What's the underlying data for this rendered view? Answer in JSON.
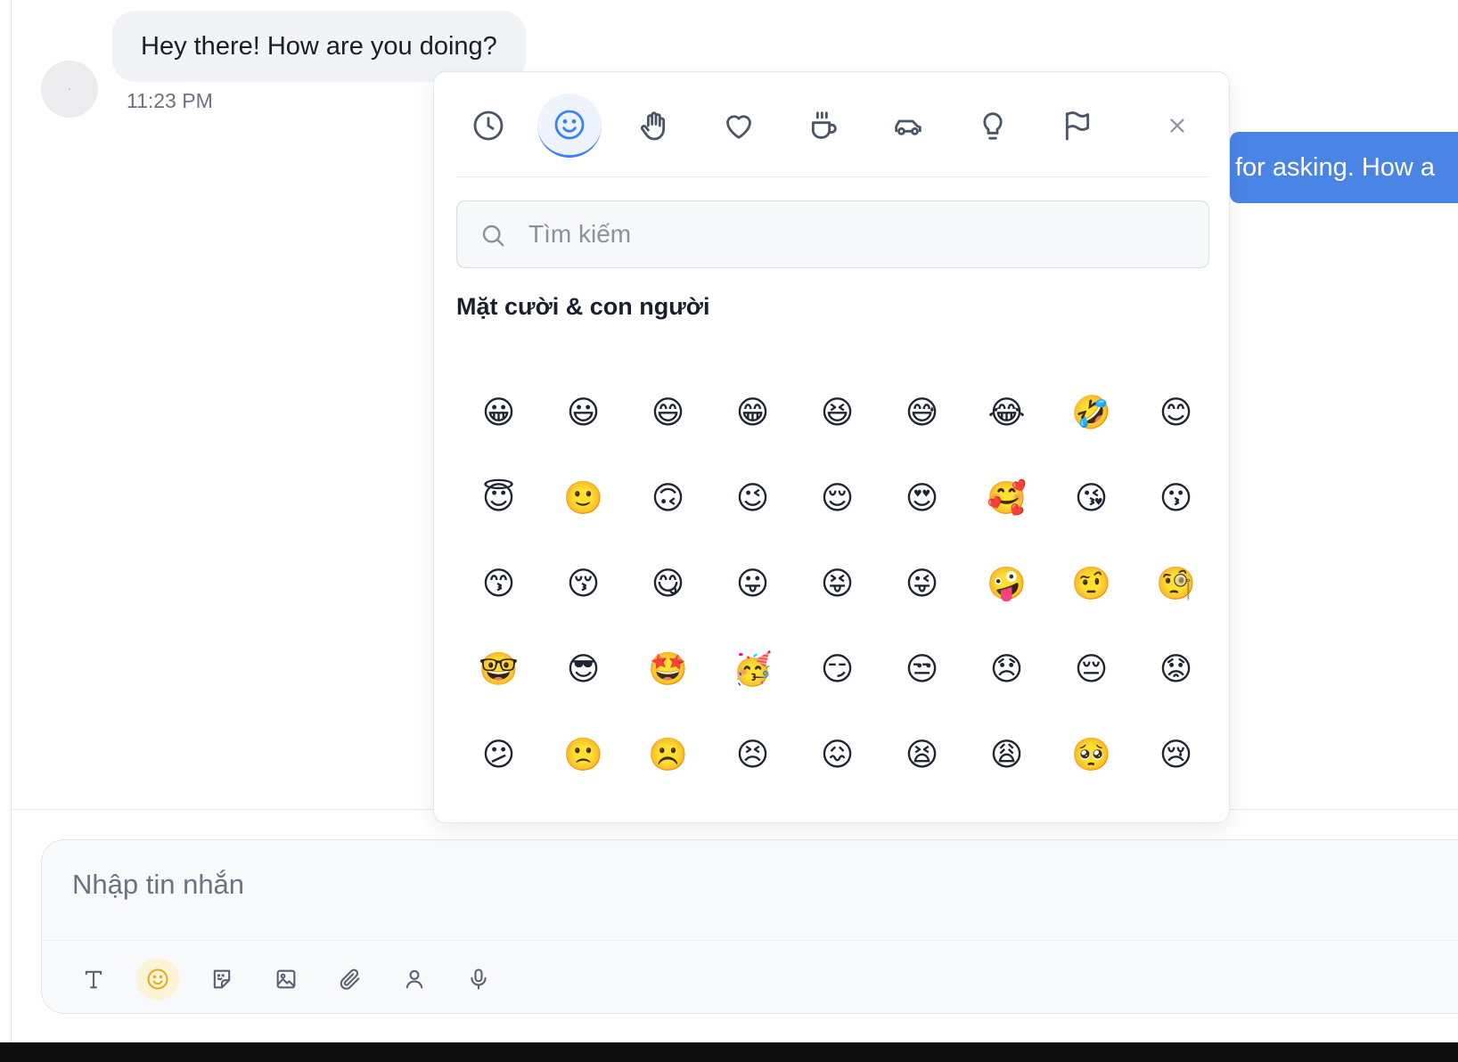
{
  "conversation": {
    "incoming_message": "Hey there! How are you doing?",
    "incoming_time": "11:23 PM",
    "outgoing_message_visible": "for asking. How a"
  },
  "emoji_picker": {
    "categories": [
      {
        "name": "recent",
        "icon": "clock-icon",
        "active": false
      },
      {
        "name": "smileys",
        "icon": "smiley-icon",
        "active": true
      },
      {
        "name": "people",
        "icon": "hand-icon",
        "active": false
      },
      {
        "name": "symbols",
        "icon": "heart-icon",
        "active": false
      },
      {
        "name": "food",
        "icon": "coffee-cup-icon",
        "active": false
      },
      {
        "name": "travel",
        "icon": "car-icon",
        "active": false
      },
      {
        "name": "objects",
        "icon": "lightbulb-icon",
        "active": false
      },
      {
        "name": "flags",
        "icon": "flag-icon",
        "active": false
      }
    ],
    "search_placeholder": "Tìm kiếm",
    "section_title": "Mặt cười & con người",
    "emojis": [
      "😀",
      "😃",
      "😄",
      "😁",
      "😆",
      "😅",
      "😂",
      "🤣",
      "😊",
      "😇",
      "🙂",
      "🙃",
      "😉",
      "😌",
      "😍",
      "🥰",
      "😘",
      "😗",
      "😙",
      "😚",
      "😋",
      "😛",
      "😝",
      "😜",
      "🤪",
      "🤨",
      "🧐",
      "🤓",
      "😎",
      "🤩",
      "🥳",
      "😏",
      "😒",
      "😞",
      "😔",
      "😟",
      "😕",
      "🙁",
      "☹️",
      "😣",
      "😖",
      "😫",
      "😩",
      "🥺",
      "😢",
      "😭",
      "😤",
      "😠",
      "😡",
      "🤬",
      "🤯",
      "😳",
      "🥵",
      "🥶"
    ]
  },
  "composer": {
    "placeholder": "Nhập tin nhắn",
    "tools": [
      "text-format-icon",
      "emoji-icon",
      "sticker-icon",
      "image-icon",
      "paperclip-icon",
      "contact-icon",
      "microphone-icon"
    ]
  },
  "colors": {
    "accent_blue": "#4a85e6",
    "emoji_tool_active": "#e0ad1e",
    "bubble_incoming": "#f2f3f6"
  }
}
